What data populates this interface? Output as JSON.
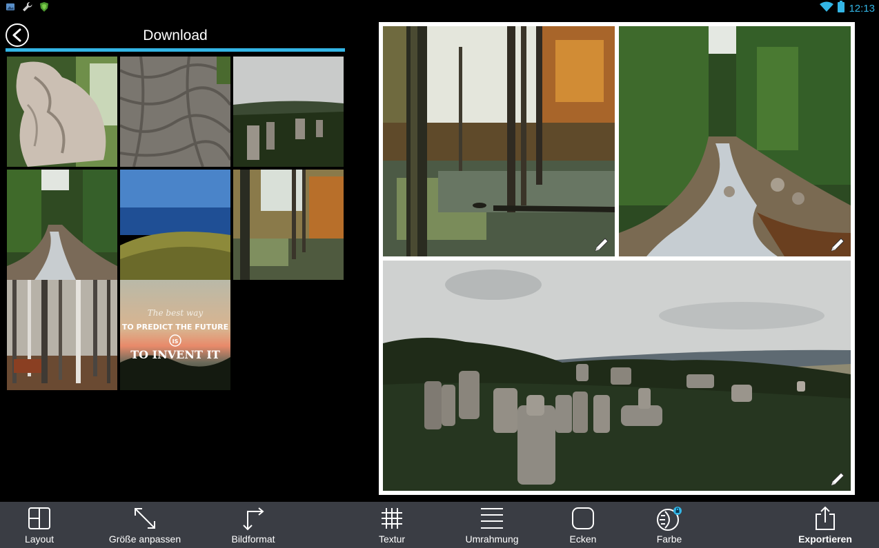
{
  "status_bar": {
    "time": "12:13",
    "left_icons": [
      "gallery-icon",
      "wrench-icon",
      "shield-icon"
    ],
    "right_icons": [
      "wifi-icon",
      "battery-icon"
    ]
  },
  "gallery": {
    "title": "Download",
    "accent_color": "#33b5e5",
    "thumbnails": [
      {
        "name": "statue"
      },
      {
        "name": "roots"
      },
      {
        "name": "rocks-panorama"
      },
      {
        "name": "forest-river"
      },
      {
        "name": "sea-view"
      },
      {
        "name": "autumn-swamp"
      },
      {
        "name": "birch-forest"
      },
      {
        "name": "quote-poster",
        "line1": "The best way",
        "line2": "TO PREDICT THE FUTURE",
        "line3": "IS",
        "line4": "TO INVENT IT"
      }
    ]
  },
  "collage": {
    "cells": [
      {
        "name": "autumn-swamp"
      },
      {
        "name": "forest-river"
      },
      {
        "name": "rocks-panorama"
      }
    ]
  },
  "toolbar": {
    "items": [
      {
        "label": "Layout",
        "icon": "layout-icon"
      },
      {
        "label": "Größe anpassen",
        "icon": "resize-icon"
      },
      {
        "label": "Bildformat",
        "icon": "aspect-ratio-icon"
      },
      {
        "label": "Textur",
        "icon": "texture-grid-icon"
      },
      {
        "label": "Umrahmung",
        "icon": "frame-lines-icon"
      },
      {
        "label": "Ecken",
        "icon": "corners-icon"
      },
      {
        "label": "Farbe",
        "icon": "color-icon"
      },
      {
        "label": "Exportieren",
        "icon": "share-export-icon"
      }
    ]
  }
}
